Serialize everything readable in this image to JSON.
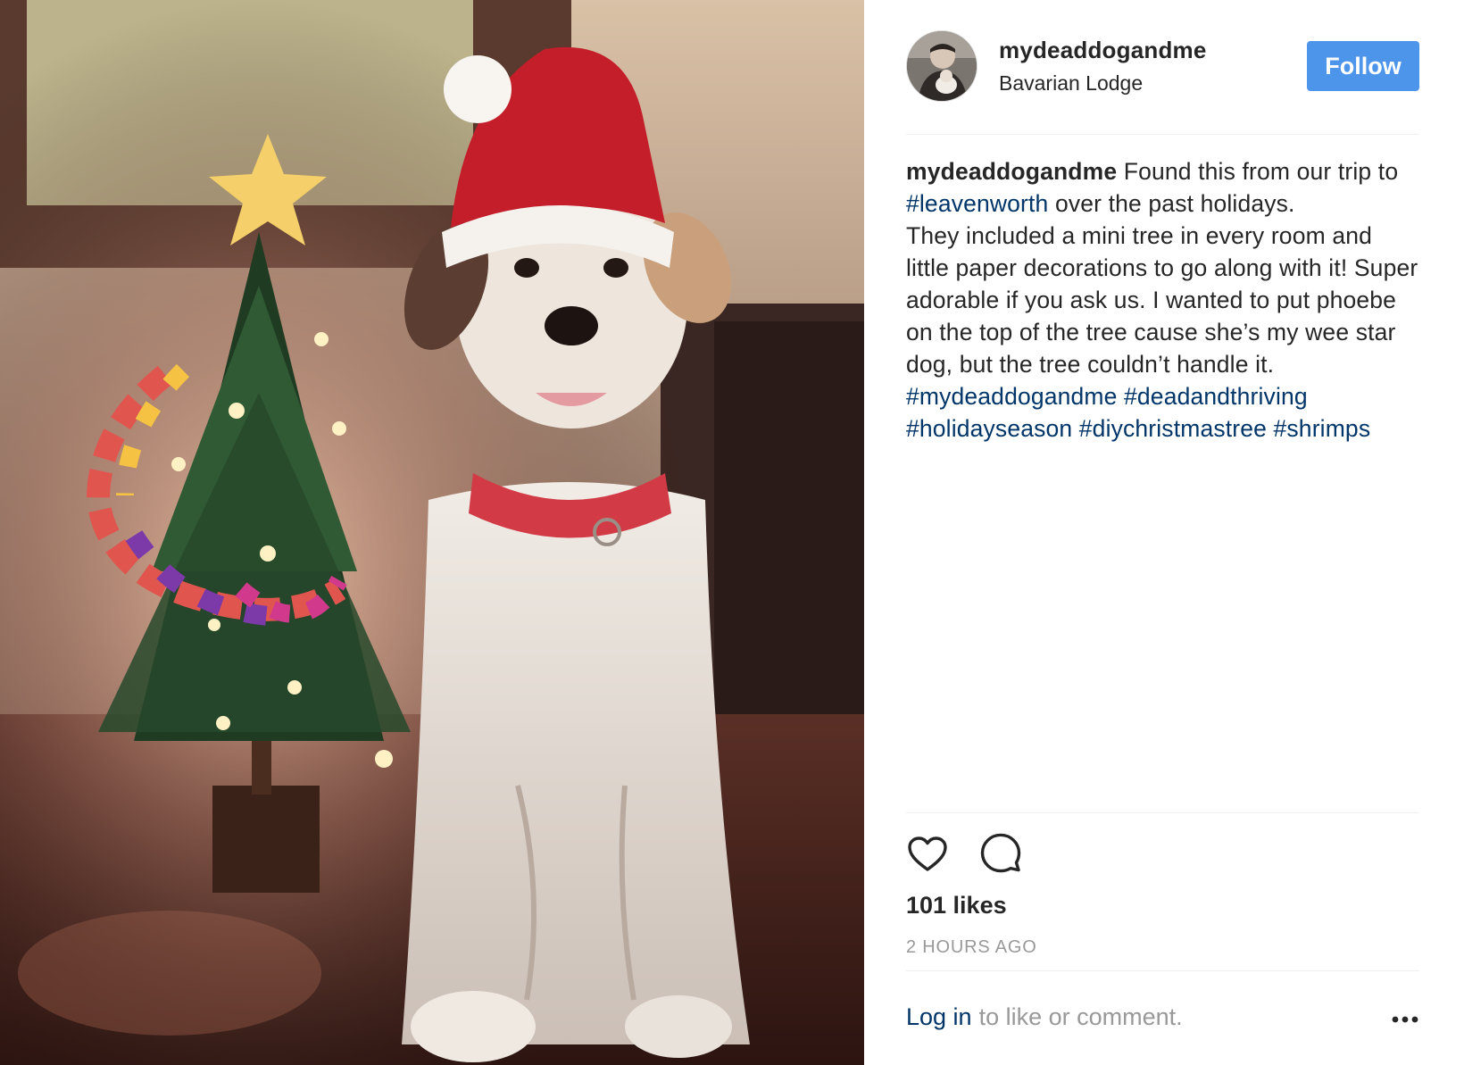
{
  "post": {
    "image": {
      "subject": "dog-in-santa-hat-next-to-christmas-tree"
    },
    "header": {
      "username": "mydeaddogandme",
      "location": "Bavarian Lodge",
      "follow_label": "Follow"
    },
    "caption": {
      "username": "mydeaddogandme",
      "text_1": " Found this from our trip to ",
      "tag_1": "#leavenworth",
      "text_2": " over the past holidays.",
      "text_3": "They included a mini tree in every room and little paper decorations to go along with it! Super adorable if you ask us. I wanted to put phoebe on the top of the tree cause she’s my wee star dog, but the tree couldn’t handle it. ",
      "tag_2": "#mydeaddogandme",
      "tag_3": "#deadandthriving",
      "tag_4": "#holidayseason",
      "tag_5": "#diychristmastree",
      "tag_6": "#shrimps"
    },
    "actions": {
      "like_icon": "heart-icon",
      "comment_icon": "comment-icon"
    },
    "likes": "101 likes",
    "timestamp": "2 HOURS AGO",
    "footer": {
      "login_label": "Log in",
      "login_suffix": "to like or comment.",
      "more_icon": "more-options-icon"
    },
    "colors": {
      "follow_button": "#4d95ea",
      "hashtag": "#003569",
      "muted": "#999999",
      "text": "#262626",
      "divider": "#efefef"
    }
  }
}
